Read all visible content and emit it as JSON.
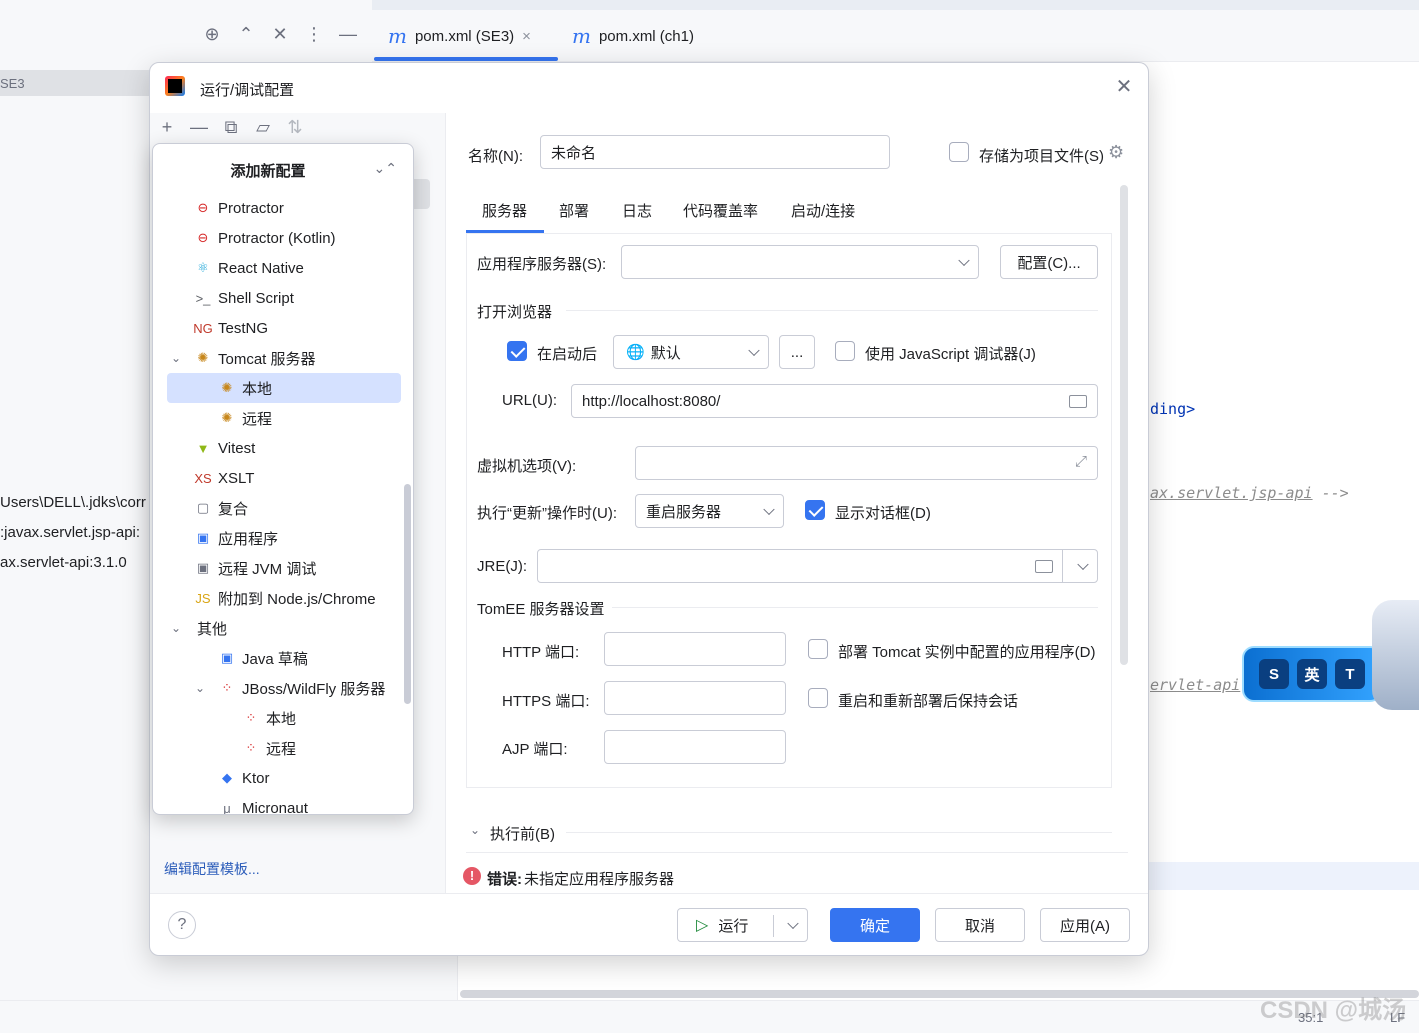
{
  "ide": {
    "tabs": [
      {
        "label": "pom.xml (SE3)",
        "icon": "m-icon",
        "active": true
      },
      {
        "label": "pom.xml (ch1)",
        "icon": "m-icon",
        "active": false
      }
    ],
    "project_row": "SE3",
    "tree_lines": [
      "Users\\DELL\\.jdks\\corr",
      ":javax.servlet.jsp-api:",
      "ax.servlet-api:3.1.0"
    ],
    "code": {
      "line1": "ding>",
      "line2_comment": "ax.servlet.jsp-api",
      "line2_end": " -->",
      "line3_comment": "ervlet-api"
    },
    "status": {
      "position": "35:1",
      "line_ending": "LF"
    },
    "watermark": "CSDN @城汤",
    "widget_buttons": [
      "S",
      "英",
      "T"
    ]
  },
  "dialog": {
    "title": "运行/调试配置",
    "toolbar": [
      {
        "name": "add-icon",
        "glyph": "+"
      },
      {
        "name": "remove-icon",
        "glyph": "—"
      },
      {
        "name": "copy-icon",
        "glyph": "⧉"
      },
      {
        "name": "new-folder-icon",
        "glyph": "▱"
      },
      {
        "name": "sort-icon",
        "glyph": "⇅"
      }
    ],
    "edit_templates_link": "编辑配置模板...",
    "help": "?",
    "popup": {
      "title": "添加新配置",
      "items": [
        {
          "label": "Protractor",
          "icon": "protractor-icon",
          "level": 0
        },
        {
          "label": "Protractor (Kotlin)",
          "icon": "protractor-icon",
          "level": 0
        },
        {
          "label": "React Native",
          "icon": "react-icon",
          "level": 0
        },
        {
          "label": "Shell Script",
          "icon": "shell-script-icon",
          "level": 0
        },
        {
          "label": "TestNG",
          "icon": "testng-icon",
          "level": 0
        },
        {
          "label": "Tomcat 服务器",
          "icon": "tomcat-icon",
          "level": 0,
          "expanded": true
        },
        {
          "label": "本地",
          "icon": "tomcat-icon",
          "level": 1,
          "selected": true
        },
        {
          "label": "远程",
          "icon": "tomcat-icon",
          "level": 1
        },
        {
          "label": "Vitest",
          "icon": "vitest-icon",
          "level": 0
        },
        {
          "label": "XSLT",
          "icon": "xslt-icon",
          "level": 0
        },
        {
          "label": "复合",
          "icon": "compound-icon",
          "level": 0
        },
        {
          "label": "应用程序",
          "icon": "application-icon",
          "level": 0
        },
        {
          "label": "远程 JVM 调试",
          "icon": "remote-jvm-icon",
          "level": 0
        },
        {
          "label": "附加到 Node.js/Chrome",
          "icon": "nodejs-icon",
          "level": 0
        },
        {
          "label": "其他",
          "icon": "",
          "level": -1,
          "expanded": true
        },
        {
          "label": "Java 草稿",
          "icon": "java-scratch-icon",
          "level": 1
        },
        {
          "label": "JBoss/WildFly 服务器",
          "icon": "jboss-icon",
          "level": 1,
          "expanded": true
        },
        {
          "label": "本地",
          "icon": "jboss-icon",
          "level": 2
        },
        {
          "label": "远程",
          "icon": "jboss-icon",
          "level": 2
        },
        {
          "label": "Ktor",
          "icon": "ktor-icon",
          "level": 1
        },
        {
          "label": "Micronaut",
          "icon": "micronaut-icon",
          "level": 1
        }
      ]
    },
    "form": {
      "name_label": "名称(N):",
      "name_value": "未命名",
      "store_as_file_label": "存储为项目文件(S)",
      "tabs": [
        "服务器",
        "部署",
        "日志",
        "代码覆盖率",
        "启动/连接"
      ],
      "app_server_label": "应用程序服务器(S):",
      "app_server_value": "",
      "configure_button": "配置(C)...",
      "open_browser_section": "打开浏览器",
      "after_launch_label": "在启动后",
      "browser_value": "默认",
      "browse_button": "...",
      "js_debugger_label": "使用 JavaScript 调试器(J)",
      "url_label": "URL(U):",
      "url_value": "http://localhost:8080/",
      "vm_options_label": "虚拟机选项(V):",
      "vm_options_value": "",
      "on_update_label": "执行“更新”操作时(U):",
      "on_update_value": "重启服务器",
      "show_dialog_label": "显示对话框(D)",
      "jre_label": "JRE(J):",
      "jre_value": "",
      "tomee_section": "TomEE 服务器设置",
      "http_port_label": "HTTP 端口:",
      "https_port_label": "HTTPS 端口:",
      "ajp_port_label": "AJP 端口:",
      "http_port_value": "",
      "https_port_value": "",
      "ajp_port_value": "",
      "deploy_tomcat_label": "部署 Tomcat 实例中配置的应用程序(D)",
      "preserve_sessions_label": "重启和重新部署后保持会话",
      "before_launch_label": "执行前(B)",
      "error_prefix": "错误:",
      "error_text": "未指定应用程序服务器"
    },
    "buttons": {
      "run": "运行",
      "ok": "确定",
      "cancel": "取消",
      "apply": "应用(A)"
    },
    "checkbox_states": {
      "store_as_file": false,
      "after_launch": true,
      "js_debugger": false,
      "show_dialog": true,
      "deploy_tomcat": false,
      "preserve_sessions": false
    },
    "colors": {
      "accent": "#3574f0",
      "error": "#e55765",
      "selection": "#d5e1ff",
      "link": "#2c5dba"
    }
  }
}
